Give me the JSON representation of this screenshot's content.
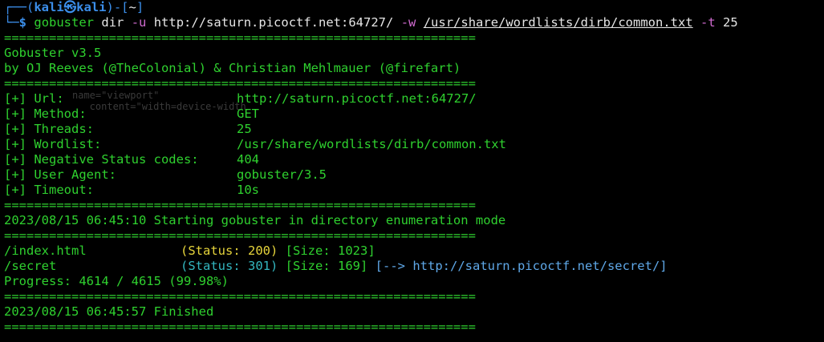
{
  "prompt": {
    "corner_top": "┌──(",
    "user": "kali",
    "at": "㉿",
    "host": "kali",
    "mid": ")-[",
    "dir": "~",
    "end": "]",
    "corner_bottom": "└─",
    "dollar": "$"
  },
  "command": {
    "program": "gobuster",
    "subcommand": "dir",
    "flag_u": "-u",
    "url": "http://saturn.picoctf.net:64727/",
    "flag_w": "-w",
    "wordlist": "/usr/share/wordlists/dirb/common.txt",
    "flag_t": "-t",
    "threads": "25"
  },
  "separator": "===============================================================",
  "banner": {
    "title": "Gobuster v3.5",
    "authors": "by OJ Reeves (@TheColonial) & Christian Mehlmauer (@firefart)"
  },
  "config": [
    {
      "label": "[+] Url:",
      "value": "http://saturn.picoctf.net:64727/"
    },
    {
      "label": "[+] Method:",
      "value": "GET"
    },
    {
      "label": "[+] Threads:",
      "value": "25"
    },
    {
      "label": "[+] Wordlist:",
      "value": "/usr/share/wordlists/dirb/common.txt"
    },
    {
      "label": "[+] Negative Status codes:",
      "value": "404"
    },
    {
      "label": "[+] User Agent:",
      "value": "gobuster/3.5"
    },
    {
      "label": "[+] Timeout:",
      "value": "10s"
    }
  ],
  "start_message": "2023/08/15 06:45:10 Starting gobuster in directory enumeration mode",
  "results": [
    {
      "path": "/index.html",
      "status": "(Status: 200)",
      "size": "[Size: 1023]",
      "redirect": ""
    },
    {
      "path": "/secret",
      "status": "(Status: 301)",
      "size": "[Size: 169]",
      "redirect": "[--> http://saturn.picoctf.net/secret/]"
    }
  ],
  "progress": "Progress: 4614 / 4615 (99.98%)",
  "finished": "2023/08/15 06:45:57 Finished",
  "colors": {
    "background": "#000000",
    "output_green": "#2fd12f",
    "prompt_blue": "#3b8eea",
    "flag_magenta": "#d06bd0",
    "status_cyan": "#33b6bf",
    "redirect_blue": "#5fa8e8"
  }
}
